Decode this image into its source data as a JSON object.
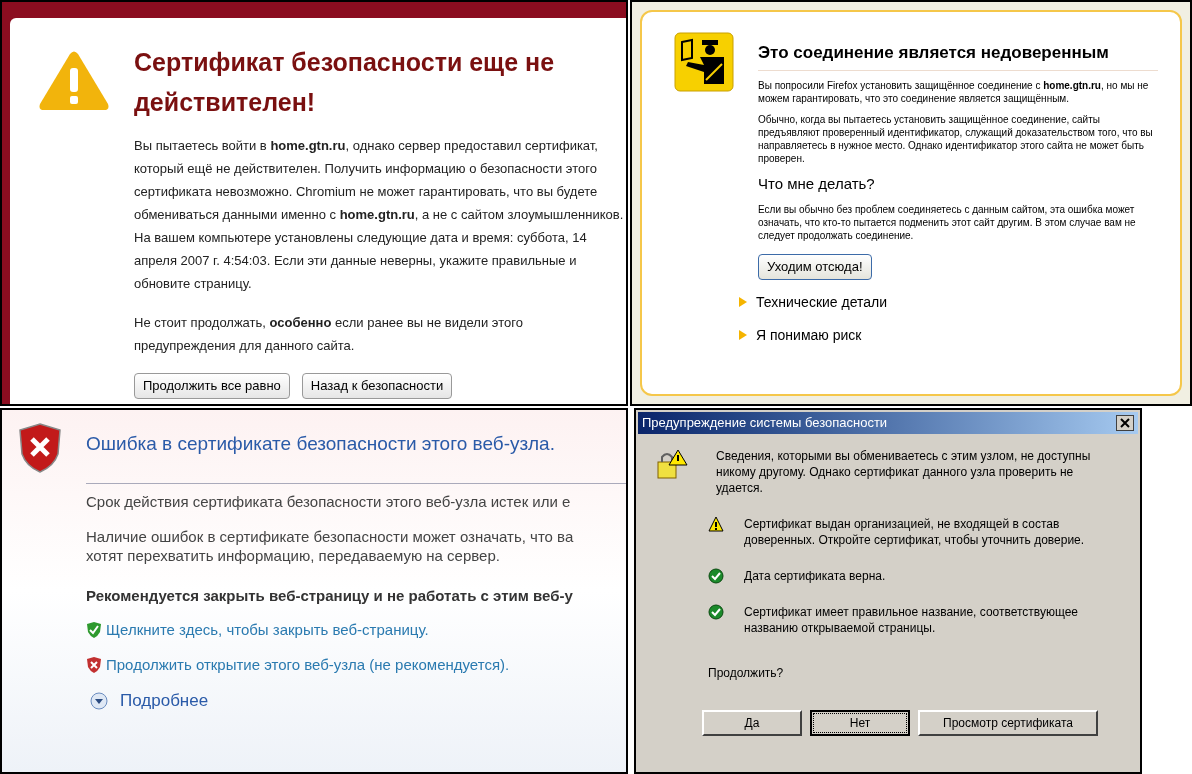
{
  "chromium_page": {
    "title": "Сертификат безопасности еще не действителен!",
    "paragraphs": [
      "Вы пытаетесь войти в **home.gtn.ru**, однако сервер предоставил сертификат, который ещё не действителен. Получить информацию о безопасности этого сертификата невозможно. Chromium не может гарантировать, что вы будете обмениваться данными именно с **home.gtn.ru**, а не с сайтом злоумышленников. На вашем компьютере установлены следующие дата и время: суббота, 14 апреля 2007 г. 4:54:03. Если эти данные неверны, укажите правильные и обновите страницу.",
      "Не стоит продолжать, **особенно** если ранее вы не видели этого предупреждения для данного сайта."
    ],
    "buttons": [
      "Продолжить все равно",
      "Назад к безопасности"
    ]
  },
  "firefox_page": {
    "title": "Это соединение является недоверенным",
    "paragraphs": [
      "Вы попросили Firefox установить защищённое соединение с **home.gtn.ru**, но мы не можем гарантировать, что это соединение является защищённым.",
      "Обычно, когда вы пытаетесь установить защищённое соединение, сайты предъявляют проверенный идентификатор, служащий доказательством того, что вы направляетесь в нужное место. Однако идентификатор этого сайта не может быть проверен."
    ],
    "subheading": "Что мне делать?",
    "advice": "Если вы обычно без проблем соединяетесь с данным сайтом, эта ошибка может означать, что кто-то пытается подменить этот сайт другим. В этом случае вам не следует продолжать соединение.",
    "button": "Уходим отсюда!",
    "expanders": [
      {
        "label": "Технические детали",
        "expanded": false
      },
      {
        "label": "Я понимаю риск",
        "expanded": false
      }
    ]
  },
  "ie_page": {
    "title": "Ошибка в сертификате безопасности этого веб-узла.",
    "paragraphs": [
      "Срок действия сертификата безопасности этого веб-узла истек или е",
      "Наличие ошибок в сертификате безопасности может означать, что ва",
      "хотят перехватить информацию, передаваемую на сервер."
    ],
    "recommendation": "Рекомендуется закрыть веб-страницу и не работать с этим веб-у",
    "links": [
      {
        "kind": "safe",
        "text": "Щелкните здесь, чтобы закрыть веб-страницу."
      },
      {
        "kind": "unsafe",
        "text": "Продолжить открытие этого веб-узла (не рекомендуется)."
      }
    ],
    "more": "Подробнее"
  },
  "security_dialog": {
    "title": "Предупреждение системы безопасности",
    "message": "Сведения, которыми вы обмениваетесь с этим узлом, не доступны никому другому. Однако сертификат данного узла проверить не удается.",
    "checks": [
      {
        "kind": "warning",
        "text": "Сертификат выдан организацией, не входящей в состав доверенных. Откройте сертификат, чтобы уточнить доверие."
      },
      {
        "kind": "ok",
        "text": "Дата сертификата верна."
      },
      {
        "kind": "ok",
        "text": "Сертификат имеет правильное название, соответствующее названию открываемой страницы."
      }
    ],
    "question": "Продолжить?",
    "buttons": [
      {
        "label": "Да",
        "default": false
      },
      {
        "label": "Нет",
        "default": true
      },
      {
        "label": "Просмотр сертификата",
        "default": false
      }
    ]
  }
}
